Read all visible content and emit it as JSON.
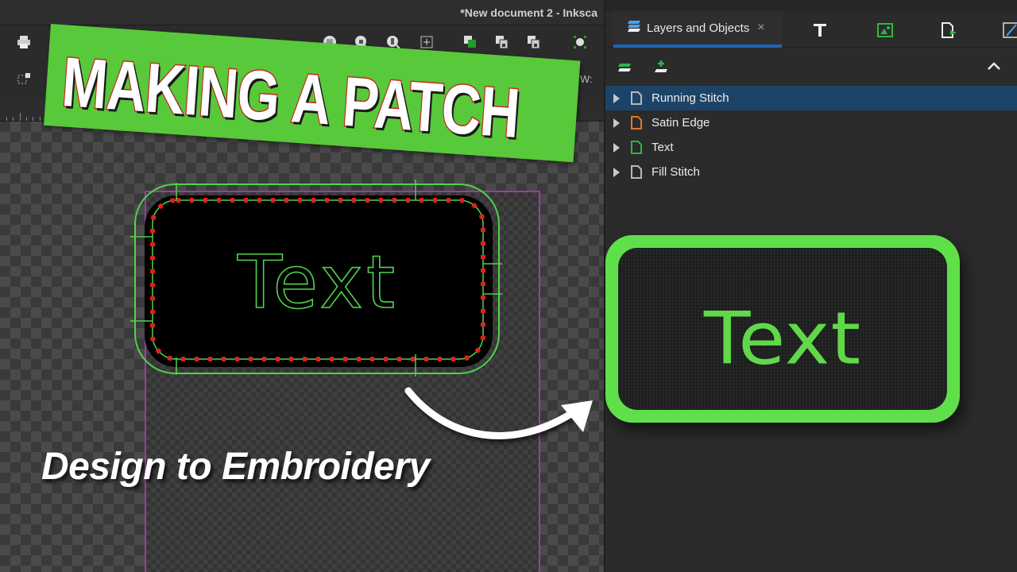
{
  "window": {
    "title": "*New document 2 - Inksca"
  },
  "toolbar": {
    "icons": [
      "print-icon",
      "cut-icon",
      "paste-icon",
      "zoom-page-icon",
      "zoom-drawing-icon",
      "zoom-selection-icon",
      "zoom-fit-icon",
      "raise-icon",
      "lock-icon",
      "unlock-icon",
      "snap-icon"
    ],
    "snap_icon": "select-same-icon",
    "w_label": "W:"
  },
  "thumbnail": {
    "banner": "MAKING A PATCH",
    "subtitle": "Design to Embroidery",
    "banner_color": "#58c93a",
    "banner_outline": "#c8261d"
  },
  "canvas": {
    "design_text": "Text",
    "stitch_color": "#4fd34a",
    "running_stitch_color": "#e0201a",
    "page_border_color": "#9a3da6"
  },
  "panel": {
    "active_tab": {
      "label": "Layers and Objects",
      "icon": "layers-icon",
      "close": "×"
    },
    "tab_icons": [
      "text-font-icon",
      "image-export-icon",
      "document-export-icon",
      "fill-stroke-icon"
    ],
    "tools": {
      "add_layer": "add-layer-icon",
      "layer_toggle": "layers-icon",
      "collapse": "^"
    },
    "layers": [
      {
        "label": "Running Stitch",
        "icon_color": "#b9b9b9",
        "selected": true
      },
      {
        "label": "Satin Edge",
        "icon_color": "#e0772d",
        "selected": false
      },
      {
        "label": "Text",
        "icon_color": "#2fb54a",
        "selected": false
      },
      {
        "label": "Fill Stitch",
        "icon_color": "#b9b9b9",
        "selected": false
      }
    ],
    "accent": "#1e64b4",
    "selected_row": "#1c4468"
  },
  "preview": {
    "patch_text": "Text",
    "border_color": "#5fe04a",
    "text_color": "#61d84a"
  }
}
